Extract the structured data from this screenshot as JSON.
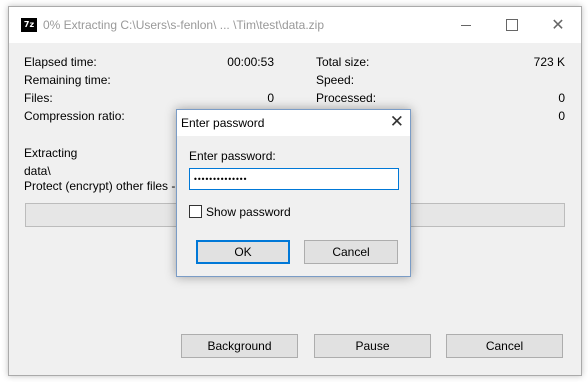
{
  "window": {
    "title": "0% Extracting C:\\Users\\s-fenlon\\ ... \\Tim\\test\\data.zip",
    "app_icon_text": "7z"
  },
  "stats": {
    "elapsed_label": "Elapsed time:",
    "elapsed_value": "00:00:53",
    "remaining_label": "Remaining time:",
    "remaining_value": "",
    "files_label": "Files:",
    "files_value": "0",
    "ratio_label": "Compression ratio:",
    "ratio_value": "",
    "total_size_label": "Total size:",
    "total_size_value": "723 K",
    "speed_label": "Speed:",
    "speed_value": "",
    "processed_label": "Processed:",
    "processed_value": "0",
    "packed_value": "0"
  },
  "status": {
    "extracting_label": "Extracting",
    "current_path": "data\\",
    "current_file": "Protect (encrypt) other files - Step"
  },
  "progress": {
    "percent": 0,
    "fill_color": "#06b025"
  },
  "buttons": {
    "background": "Background",
    "pause": "Pause",
    "cancel": "Cancel"
  },
  "dialog": {
    "title": "Enter password",
    "prompt_label": "Enter password:",
    "password_masked": "••••••••••••••",
    "show_password_label": "Show password",
    "show_password_checked": false,
    "ok": "OK",
    "cancel": "Cancel"
  }
}
